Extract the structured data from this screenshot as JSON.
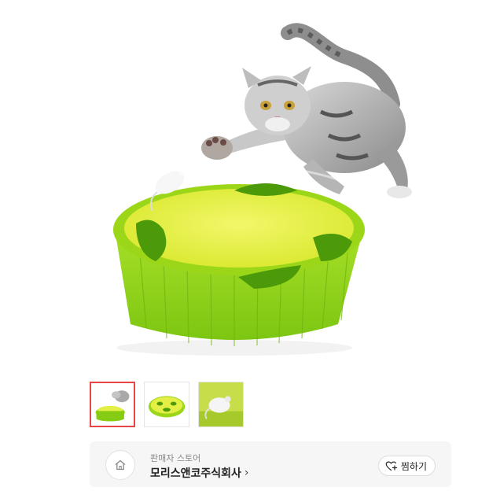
{
  "product": {
    "main_image": "cat-toy-product-image",
    "thumbnails": [
      {
        "icon": "cat-toy-thumbnail",
        "selected": true
      },
      {
        "icon": "green-toy-top-view-thumbnail",
        "selected": false
      },
      {
        "icon": "mouse-toy-closeup-thumbnail",
        "selected": false
      }
    ]
  },
  "seller": {
    "caption": "판매자 스토어",
    "name": "모리스앤코주식회사",
    "chevron": "›",
    "favorite_label": "찜하기",
    "home_icon": "home-icon",
    "heart_icon": "heart-plus-icon"
  },
  "colors": {
    "accent_border": "#e84545",
    "toy_green": "#9ad31a"
  }
}
